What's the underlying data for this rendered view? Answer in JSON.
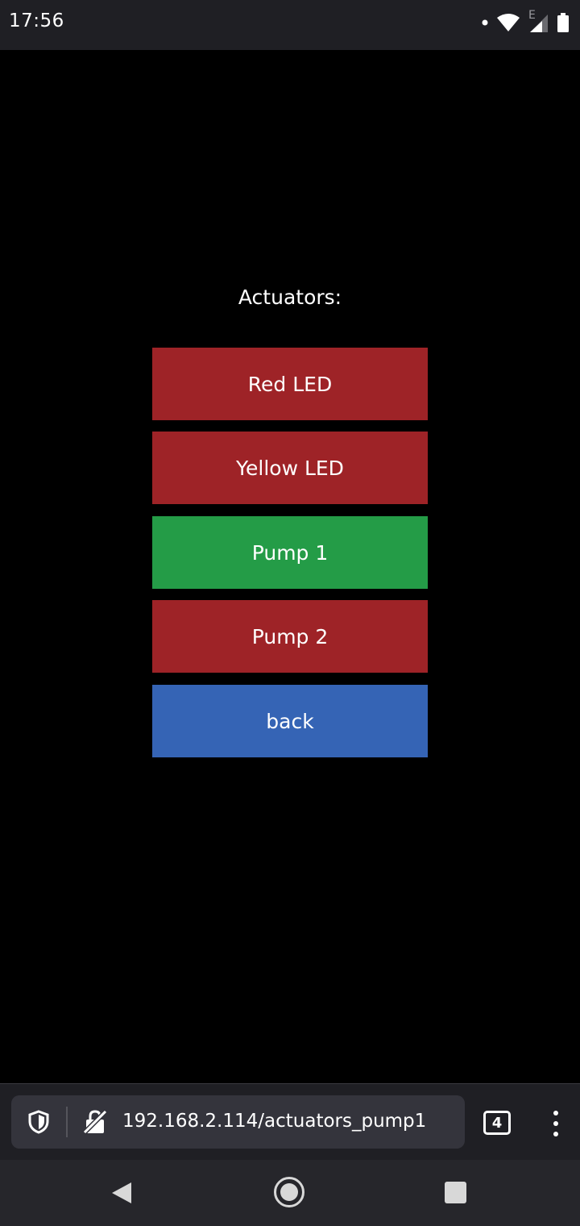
{
  "status_bar": {
    "time": "17:56",
    "network_type": "E",
    "icons": [
      "notification-dot-icon",
      "wifi-icon",
      "cellular-signal-icon",
      "battery-icon"
    ]
  },
  "page": {
    "heading": "Actuators:",
    "buttons": [
      {
        "label": "Red LED",
        "color": "#9e2327"
      },
      {
        "label": "Yellow LED",
        "color": "#9e2327"
      },
      {
        "label": "Pump 1",
        "color": "#249c47"
      },
      {
        "label": "Pump 2",
        "color": "#9e2327"
      },
      {
        "label": "back",
        "color": "#3564b5"
      }
    ]
  },
  "browser": {
    "url": "192.168.2.114/actuators_pump1",
    "tab_count": "4",
    "icons": [
      "shield-icon",
      "not-secure-lock-icon",
      "tabs-icon",
      "more-vert-icon"
    ]
  },
  "nav_bar": {
    "icons": [
      "back-triangle-icon",
      "home-circle-icon",
      "recents-square-icon"
    ]
  }
}
